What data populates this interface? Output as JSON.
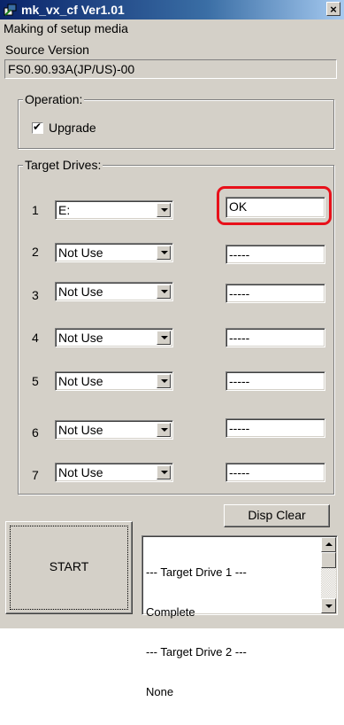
{
  "window": {
    "title": "mk_vx_cf Ver1.01",
    "close_glyph": "×",
    "icon": "app-icon"
  },
  "header": {
    "subtitle": "Making of setup media",
    "source_version_label": "Source Version",
    "source_version_value": "FS0.90.93A(JP/US)-00"
  },
  "operation": {
    "group_label": "Operation:",
    "upgrade_label": "Upgrade",
    "upgrade_checked": true,
    "check_glyph": "✔"
  },
  "target_drives": {
    "group_label": "Target Drives:",
    "rows": [
      {
        "num": "1",
        "drive": "E:",
        "status": "OK"
      },
      {
        "num": "2",
        "drive": "Not Use",
        "status": "-----"
      },
      {
        "num": "3",
        "drive": "Not Use",
        "status": "-----"
      },
      {
        "num": "4",
        "drive": "Not Use",
        "status": "-----"
      },
      {
        "num": "5",
        "drive": "Not Use",
        "status": "-----"
      },
      {
        "num": "6",
        "drive": "Not Use",
        "status": "-----"
      },
      {
        "num": "7",
        "drive": "Not Use",
        "status": "-----"
      }
    ]
  },
  "buttons": {
    "disp_clear": "Disp Clear",
    "start": "START"
  },
  "log": {
    "lines": [
      "--- Target Drive 1 ---",
      "Complete",
      "--- Target Drive 2 ---",
      "None"
    ]
  },
  "colors": {
    "highlight": "#e8101a",
    "title_bar": "#0a246a",
    "face": "#d4d0c8"
  }
}
